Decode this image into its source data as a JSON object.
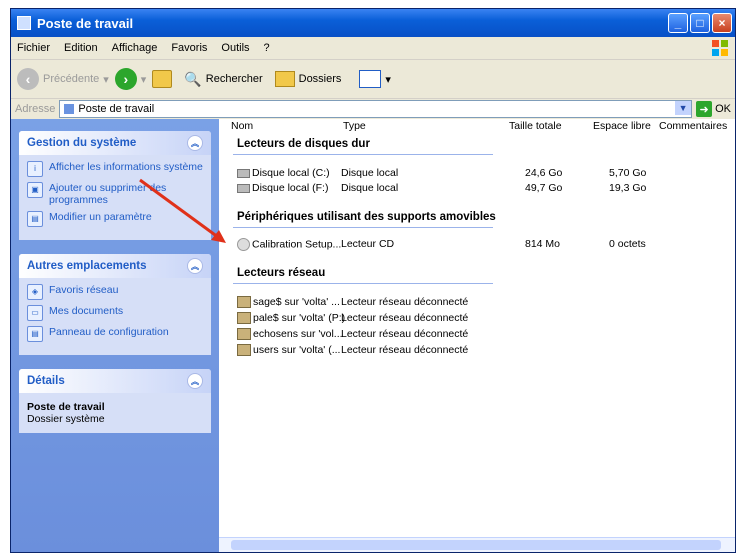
{
  "window": {
    "title": "Poste de travail"
  },
  "menu": [
    "Fichier",
    "Edition",
    "Affichage",
    "Favoris",
    "Outils",
    "?"
  ],
  "toolbar": {
    "back": "Précédente",
    "search": "Rechercher",
    "folders": "Dossiers"
  },
  "address": {
    "label": "Adresse",
    "value": "Poste de travail",
    "go": "OK"
  },
  "sidebar": {
    "system": {
      "title": "Gestion du système",
      "links": [
        "Afficher les informations système",
        "Ajouter ou supprimer des programmes",
        "Modifier un paramètre"
      ]
    },
    "places": {
      "title": "Autres emplacements",
      "links": [
        "Favoris réseau",
        "Mes documents",
        "Panneau de configuration"
      ]
    },
    "details": {
      "title": "Détails",
      "name": "Poste de travail",
      "desc": "Dossier système"
    }
  },
  "columns": [
    "Nom",
    "Type",
    "Taille totale",
    "Espace libre",
    "Commentaires"
  ],
  "groups": {
    "hdd": "Lecteurs de disques dur",
    "removable": "Périphériques utilisant des supports amovibles",
    "network": "Lecteurs réseau"
  },
  "hdd_rows": [
    {
      "name": "Disque local (C:)",
      "type": "Disque local",
      "total": "24,6 Go",
      "free": "5,70 Go"
    },
    {
      "name": "Disque local (F:)",
      "type": "Disque local",
      "total": "49,7 Go",
      "free": "19,3 Go"
    }
  ],
  "removable_rows": [
    {
      "name": "Calibration Setup...",
      "type": "Lecteur CD",
      "total": "814 Mo",
      "free": "0 octets"
    }
  ],
  "network_rows": [
    {
      "name": "sage$ sur 'volta' ...",
      "type": "Lecteur réseau déconnecté"
    },
    {
      "name": "pale$ sur 'volta' (P:)",
      "type": "Lecteur réseau déconnecté"
    },
    {
      "name": "echosens sur 'vol...",
      "type": "Lecteur réseau déconnecté"
    },
    {
      "name": "users sur 'volta' (...",
      "type": "Lecteur réseau déconnecté"
    }
  ],
  "colors": {
    "titlebar": "#0a5fd8",
    "sidebar": "#6b8fdc",
    "link": "#215dc6",
    "annotation": "#e0311a"
  }
}
